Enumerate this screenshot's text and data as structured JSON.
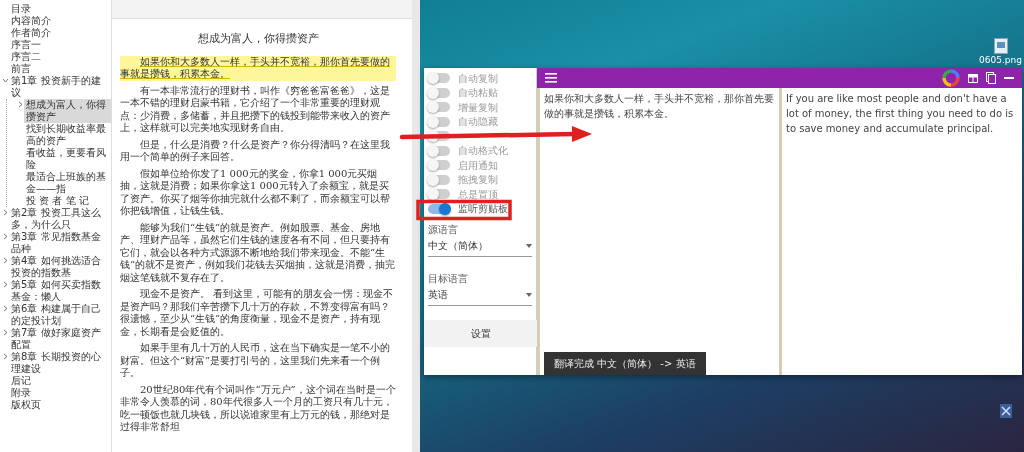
{
  "toc": {
    "items": [
      {
        "label": "目录"
      },
      {
        "label": "内容简介"
      },
      {
        "label": "作者简介"
      },
      {
        "label": "序言一"
      },
      {
        "label": "序言二"
      },
      {
        "label": "前言"
      },
      {
        "label": "第1章 投资新手的建议",
        "expanded": true,
        "children": [
          {
            "label": "想成为富人，你得攒资产",
            "expanded": false,
            "selected": true
          },
          {
            "label": "找到长期收益率最高的资产",
            "selected": false
          },
          {
            "label": "看收益，更要看风险",
            "selected": false
          },
          {
            "label": "最适合上班族的基金——指",
            "selected": false
          },
          {
            "label": "投 资 者 笔 记",
            "selected": false
          }
        ]
      },
      {
        "label": "第2章 投资工具这么多，为什么只",
        "expanded": false
      },
      {
        "label": "第3章 常见指数基金品种",
        "expanded": false
      },
      {
        "label": "第4章 如何挑选适合投资的指数基",
        "expanded": false
      },
      {
        "label": "第5章 如何买卖指数基金：懒人",
        "expanded": false
      },
      {
        "label": "第6章 构建属于自己的定投计划",
        "expanded": false
      },
      {
        "label": "第7章 做好家庭资产配置",
        "expanded": false
      },
      {
        "label": "第8章 长期投资的心理建设",
        "expanded": false
      },
      {
        "label": "后记"
      },
      {
        "label": "附录"
      },
      {
        "label": "版权页"
      }
    ]
  },
  "document": {
    "title": "想成为富人，你得攒资产",
    "paragraphs": [
      {
        "text": "如果你和大多数人一样，手头并不宽裕，那你首先要做的事就是攒钱，积累本金。",
        "highlighted": true
      },
      {
        "text": "有一本非常流行的理财书，叫作《穷爸爸富爸爸》，这是一本不错的理财启蒙书籍，它介绍了一个非常重要的理财观点：少消费，多储蓄，并且把攒下的钱投到能带来收入的资产上，这样就可以完美地实现财务自由。",
        "highlighted": false
      },
      {
        "text": "但是，什么是消费？什么是资产？你分得清吗？在这里我用一个简单的例子来回答。",
        "highlighted": false
      },
      {
        "text": "假如单位给你发了1 000元的奖金，你拿1 000元买烟抽，这就是消费；如果你拿这1 000元转入了余额宝，就是买了资产。你买了烟等你抽完就什么都不剩了，而余额宝可以帮你把钱增值，让钱生钱。",
        "highlighted": false
      },
      {
        "text": "能够为我们“生钱”的就是资产。例如股票、基金、房地产、理财产品等，虽然它们生钱的速度各有不同，但只要持有它们，就会以各种方式源源不断地给我们带来现金。不能“生钱”的就不是资产，例如我们花钱去买烟抽，这就是消费，抽完烟这笔钱就不复存在了。",
        "highlighted": false
      },
      {
        "text": "现金不是资产。 看到这里，可能有的朋友会一愣：现金不是资产吗？那我们辛苦攒下几十万的存款，不算变得富有吗？很遗憾，至少从“生钱”的角度衡量，现金不是资产，持有现金，长期看是会贬值的。",
        "highlighted": false
      },
      {
        "text": "如果手里有几十万的人民币，这在当下确实是一笔不小的财富。但这个“财富”是要打引号的，这里我们先来看一个例子。",
        "highlighted": false
      },
      {
        "text": "20世纪80年代有个词叫作“万元户”，这个词在当时是一个非常令人羡慕的词，80年代很多人一个月的工资只有几十元，吃一顿饭也就几块钱，所以说谁家里有上万元的钱，那绝对是过得非常舒坦",
        "highlighted": false
      }
    ]
  },
  "desktop_icons": [
    {
      "label": "0605.png"
    }
  ],
  "translator": {
    "toggles": [
      {
        "label": "自动复制",
        "on": false
      },
      {
        "label": "自动粘贴",
        "on": false
      },
      {
        "label": "增量复制",
        "on": false
      },
      {
        "label": "自动隐藏",
        "on": false
      },
      {
        "on": false
      },
      {
        "label": "自动格式化",
        "on": false
      },
      {
        "label": "启用通知",
        "on": false
      },
      {
        "label": "拖拽复制",
        "on": false
      },
      {
        "label": "总是置顶",
        "on": false
      },
      {
        "label": "监听剪贴板",
        "on": true
      }
    ],
    "source_language": {
      "label": "源语言",
      "value": "中文（简体）"
    },
    "target_language": {
      "label": "目标语言",
      "value": "英语"
    },
    "settings_button": "设置",
    "source_text": "如果你和大多数人一样，手头并不宽裕，那你首先要做的事就是攒钱，积累本金。",
    "translated_text": "If you are like most people and don't have a lot of money, the first thing you need to do is to save money and accumulate principal.",
    "toast": "翻译完成 中文（简体） -> 英语"
  }
}
